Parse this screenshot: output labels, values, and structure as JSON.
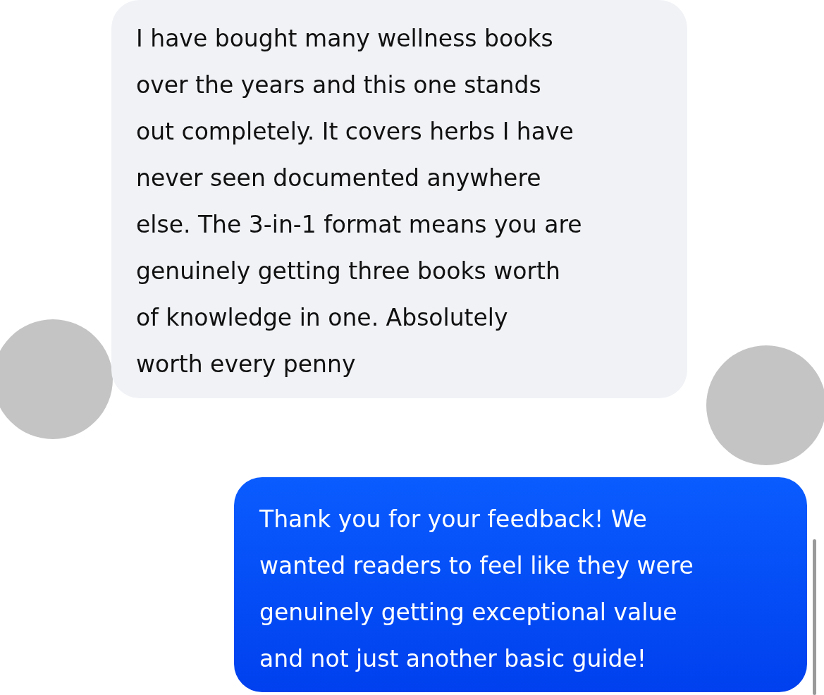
{
  "messages": [
    {
      "kind": "incoming",
      "lines": [
        "I have bought many wellness books",
        "over the years and this one stands",
        "out completely. It covers herbs I have",
        "never seen documented anywhere",
        "else. The 3-in-1 format means you are",
        "genuinely getting three books worth",
        "of knowledge in one. Absolutely",
        "worth every penny"
      ]
    },
    {
      "kind": "outgoing",
      "lines": [
        "Thank you for your feedback! We",
        "wanted readers to feel like they were",
        "genuinely getting exceptional value",
        "and not just another basic guide!"
      ]
    }
  ]
}
